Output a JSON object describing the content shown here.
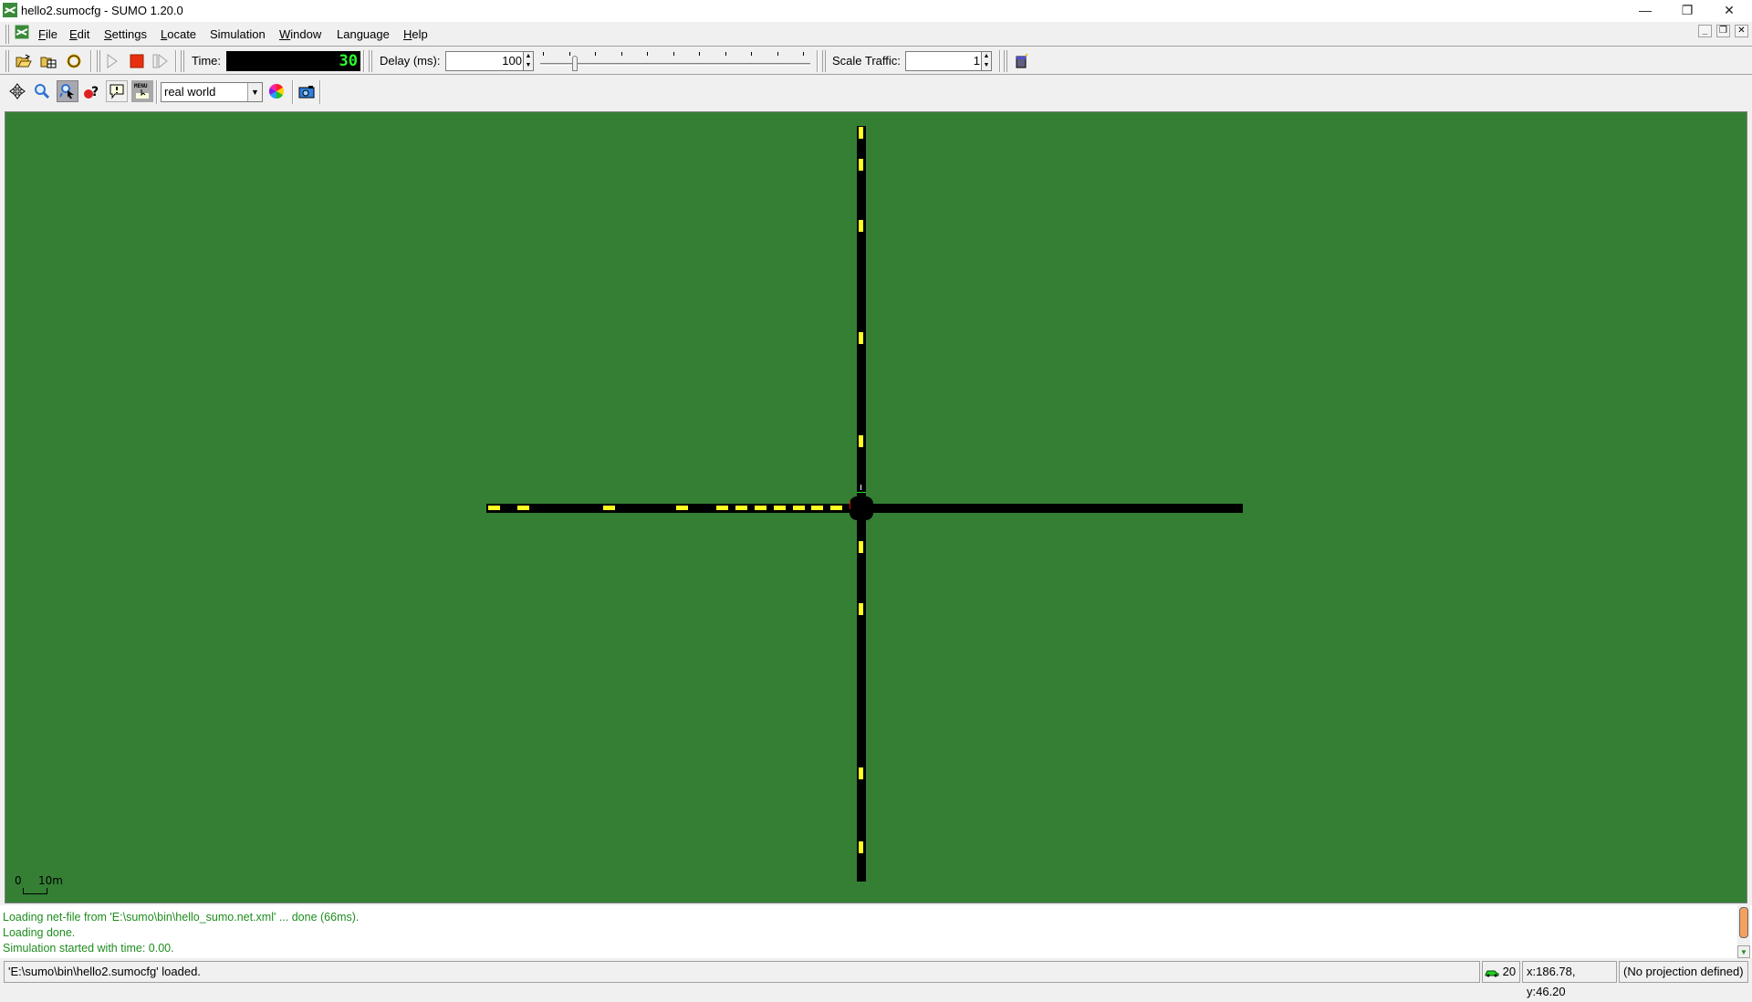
{
  "window": {
    "title": "hello2.sumocfg - SUMO 1.20.0",
    "controls": {
      "minimize": "—",
      "restore": "❐",
      "close": "✕"
    }
  },
  "menubar": {
    "items": [
      {
        "label": "File",
        "mnemonic": "F"
      },
      {
        "label": "Edit",
        "mnemonic": "E"
      },
      {
        "label": "Settings",
        "mnemonic": "S"
      },
      {
        "label": "Locate",
        "mnemonic": "L"
      },
      {
        "label": "Simulation",
        "mnemonic": ""
      },
      {
        "label": "Window",
        "mnemonic": "W"
      },
      {
        "label": "Language",
        "mnemonic": ""
      },
      {
        "label": "Help",
        "mnemonic": "H"
      }
    ],
    "mdi_controls": {
      "minimize": "_",
      "restore": "❐",
      "close": "✕"
    }
  },
  "toolbar": {
    "open_icon": "open-folder-icon",
    "open_network_icon": "open-network-icon",
    "reload_icon": "reload-icon",
    "run_icon": "play-icon",
    "stop_icon": "stop-icon",
    "step_icon": "step-icon",
    "time_label": "Time:",
    "time_value": "30",
    "delay_label": "Delay (ms):",
    "delay_value": "100",
    "delay_slider_fraction": 0.12,
    "scale_traffic_label": "Scale Traffic:",
    "scale_traffic_value": "1",
    "new_view_icon": "new-view-icon"
  },
  "view_toolbar": {
    "recenter_icon": "recenter-icon",
    "zoom_icon": "zoom-icon",
    "locate_icon": "locate-icon",
    "help_icon": "help-icon",
    "tooltip_icon": "tooltip-icon",
    "menu_icon": "menu-icon",
    "menu_icon_text": "MENU",
    "scheme_selected": "real world",
    "color_wheel_icon": "color-wheel-icon",
    "screenshot_icon": "camera-icon"
  },
  "canvas": {
    "background_color": "#347f34",
    "road_color": "#000000",
    "vehicle_color": "#ffff20",
    "scale_label_start": "0",
    "scale_label_end": "10m",
    "westbound_queue_vehicles": 11,
    "northern_approach_vehicles": 5,
    "southern_leg_vehicles": 4
  },
  "log": {
    "lines": [
      "Loading net-file from 'E:\\sumo\\bin\\hello_sumo.net.xml' ... done (66ms).",
      "Loading done.",
      "Simulation started with time: 0.00."
    ],
    "text_color": "#1f8c1f"
  },
  "statusbar": {
    "message": "'E:\\sumo\\bin\\hello2.sumocfg' loaded.",
    "vehicle_count": "20",
    "coordinates": "x:186.78, y:46.20",
    "projection": "(No projection defined)"
  }
}
